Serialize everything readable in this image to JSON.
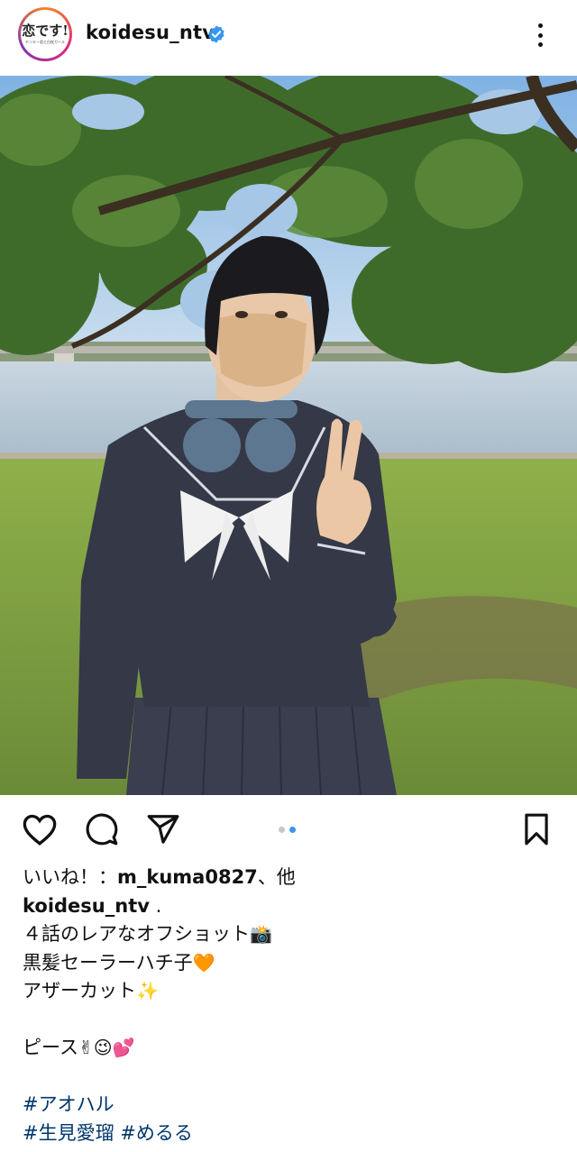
{
  "post": {
    "username": "koidesu_ntv",
    "avatar_logo": "恋です!",
    "avatar_sub": "ヤンキー君と白杖ガール"
  },
  "carousel": {
    "count": 2,
    "active_index": 1
  },
  "likes": {
    "prefix": "いいね！：",
    "user": "m_kuma0827",
    "suffix": "、他"
  },
  "caption": {
    "author": "koidesu_ntv",
    "first_tail": " .",
    "line1": "４話のレアなオフショット",
    "line1_emoji": "📸",
    "line2": "黒髪セーラーハチ子",
    "line2_emoji": "🧡",
    "line3": "アザーカット",
    "line3_emoji": "✨",
    "line4": "ピース",
    "line4_emoji": "✌😉💕",
    "hashtags_line1": [
      "#アオハル"
    ],
    "hashtags_line2": [
      "#生見愛瑠",
      "#めるる"
    ]
  },
  "colors": {
    "verified": "#3897f0",
    "hashtag": "#00376b",
    "dot_active": "#3897f0",
    "dot_inactive": "#c7c7c7"
  },
  "icons": {
    "verified": "verified-badge-icon",
    "more": "more-options-icon",
    "like": "heart-icon",
    "comment": "comment-icon",
    "share": "send-icon",
    "save": "bookmark-icon"
  }
}
